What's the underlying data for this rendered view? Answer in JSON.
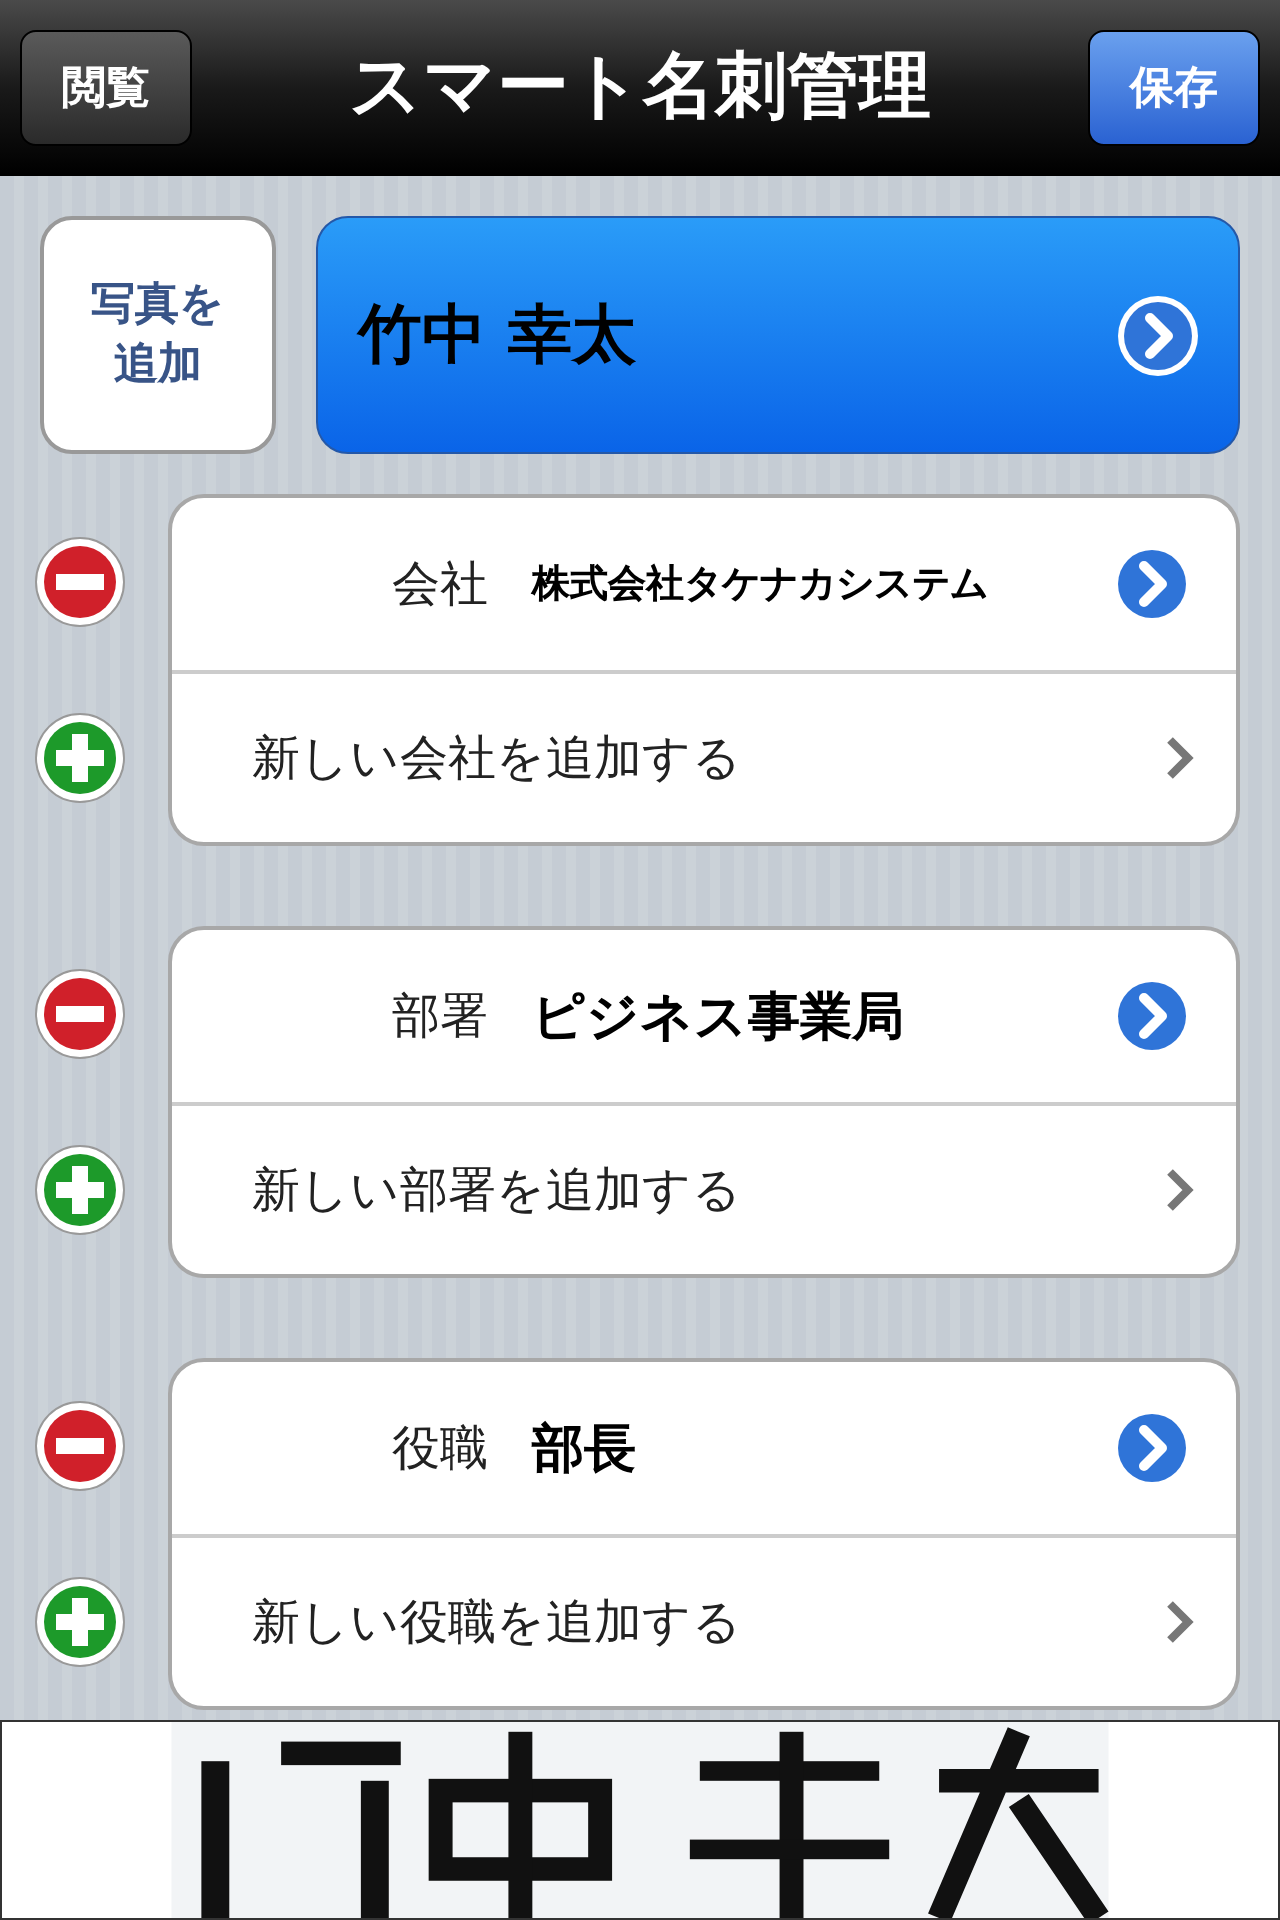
{
  "nav_bar": {
    "title": "スマート名刺管理",
    "left_button": "閲覧",
    "right_button": "保存"
  },
  "photo_button": "写真を追加",
  "name_button": "竹中 幸太",
  "fields": [
    {
      "label": "会社",
      "value": "株式会社タケナカシステム",
      "add_label": "新しい会社を追加する"
    },
    {
      "label": "部署",
      "value": "ピジネス事業局",
      "add_label": "新しい部署を追加する"
    },
    {
      "label": "役職",
      "value": "部長",
      "add_label": "新しい役職を追加する"
    }
  ]
}
